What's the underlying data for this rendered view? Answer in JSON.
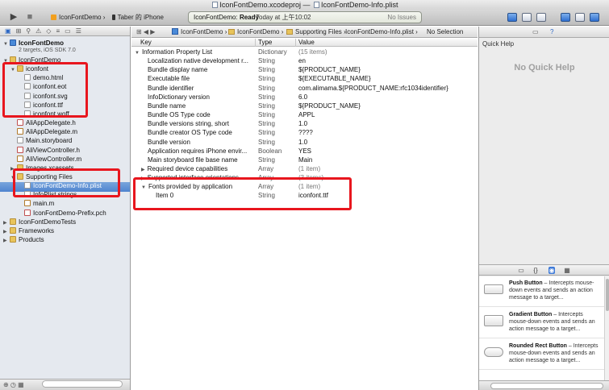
{
  "window": {
    "title_project": "IconFontDemo.xcodeproj",
    "title_sep": "—",
    "title_file": "IconFontDemo-Info.plist"
  },
  "toolbar": {
    "run_icon": "▶",
    "stop_icon": "■",
    "scheme_target": "IconFontDemo",
    "scheme_sep": "›",
    "scheme_device": "Taber 的 iPhone",
    "status_project": "IconFontDemo:",
    "status_state": "Ready",
    "status_time": "Today at 上午10:02",
    "status_issues": "No Issues"
  },
  "navigator": {
    "filter_icons": [
      "▣",
      "⊞",
      "⚲",
      "⚠",
      "◇",
      "≡",
      "▭",
      "☰"
    ],
    "project_name": "IconFontDemo",
    "project_subtitle": "2 targets, iOS SDK 7.0",
    "items": [
      {
        "label": "IconFontDemo",
        "kind": "folder",
        "indent": 1,
        "open": true
      },
      {
        "label": "iconfont",
        "kind": "folder",
        "indent": 2,
        "open": true
      },
      {
        "label": "demo.html",
        "kind": "file",
        "indent": 3
      },
      {
        "label": "iconfont.eot",
        "kind": "file",
        "indent": 3
      },
      {
        "label": "iconfont.svg",
        "kind": "file",
        "indent": 3
      },
      {
        "label": "iconfont.ttf",
        "kind": "file",
        "indent": 3
      },
      {
        "label": "iconfont.woff",
        "kind": "file",
        "indent": 3
      },
      {
        "label": "AliAppDelegate.h",
        "kind": "hfile",
        "indent": 2
      },
      {
        "label": "AliAppDelegate.m",
        "kind": "mfile",
        "indent": 2
      },
      {
        "label": "Main.storyboard",
        "kind": "file",
        "indent": 2
      },
      {
        "label": "AliViewController.h",
        "kind": "hfile",
        "indent": 2
      },
      {
        "label": "AliViewController.m",
        "kind": "mfile",
        "indent": 2
      },
      {
        "label": "Images.xcassets",
        "kind": "folder",
        "indent": 2
      },
      {
        "label": "Supporting Files",
        "kind": "folder",
        "indent": 2,
        "open": true
      },
      {
        "label": "IconFontDemo-Info.plist",
        "kind": "file",
        "indent": 3,
        "selected": true
      },
      {
        "label": "InfoPlist.strings",
        "kind": "file",
        "indent": 3
      },
      {
        "label": "main.m",
        "kind": "mfile",
        "indent": 3
      },
      {
        "label": "IconFontDemo-Prefix.pch",
        "kind": "hfile",
        "indent": 3
      },
      {
        "label": "IconFontDemoTests",
        "kind": "folder",
        "indent": 1
      },
      {
        "label": "Frameworks",
        "kind": "folder",
        "indent": 1
      },
      {
        "label": "Products",
        "kind": "folder",
        "indent": 1
      }
    ],
    "bottom_icons": "⊕  ◷  ▦"
  },
  "jumpbar": {
    "nav_icons": "⊞ ◀ ▶",
    "crumbs": [
      "IconFontDemo",
      "IconFontDemo",
      "Supporting Files",
      "IconFontDemo-Info.plist",
      "No Selection"
    ]
  },
  "plist": {
    "col_key": "Key",
    "col_type": "Type",
    "col_value": "Value",
    "rows": [
      {
        "key": "Information Property List",
        "type": "Dictionary",
        "value": "(15 items)",
        "level": 0,
        "arrow": "▼"
      },
      {
        "key": "Localization native development r...",
        "type": "String",
        "value": "en",
        "level": 1
      },
      {
        "key": "Bundle display name",
        "type": "String",
        "value": "${PRODUCT_NAME}",
        "level": 1
      },
      {
        "key": "Executable file",
        "type": "String",
        "value": "${EXECUTABLE_NAME}",
        "level": 1
      },
      {
        "key": "Bundle identifier",
        "type": "String",
        "value": "com.alimama.${PRODUCT_NAME:rfc1034identifier}",
        "level": 1
      },
      {
        "key": "InfoDictionary version",
        "type": "String",
        "value": "6.0",
        "level": 1
      },
      {
        "key": "Bundle name",
        "type": "String",
        "value": "${PRODUCT_NAME}",
        "level": 1
      },
      {
        "key": "Bundle OS Type code",
        "type": "String",
        "value": "APPL",
        "level": 1
      },
      {
        "key": "Bundle versions string, short",
        "type": "String",
        "value": "1.0",
        "level": 1
      },
      {
        "key": "Bundle creator OS Type code",
        "type": "String",
        "value": "????",
        "level": 1
      },
      {
        "key": "Bundle version",
        "type": "String",
        "value": "1.0",
        "level": 1
      },
      {
        "key": "Application requires iPhone envir...",
        "type": "Boolean",
        "value": "YES",
        "level": 1
      },
      {
        "key": "Main storyboard file base name",
        "type": "String",
        "value": "Main",
        "level": 1
      },
      {
        "key": "Required device capabilities",
        "type": "Array",
        "value": "(1 item)",
        "level": 1,
        "arrow": "▶"
      },
      {
        "key": "Supported interface orientations",
        "type": "Array",
        "value": "(3 items)",
        "level": 1,
        "arrow": "▶"
      },
      {
        "key": "Fonts provided by application",
        "type": "Array",
        "value": "(1 item)",
        "level": 1,
        "arrow": "▼"
      },
      {
        "key": "Item 0",
        "type": "String",
        "value": "iconfont.ttf",
        "level": 2
      }
    ]
  },
  "utility": {
    "tab_icons": [
      "▭",
      "?"
    ],
    "quick_help_title": "Quick Help",
    "quick_help_empty": "No Quick Help",
    "library_tabs": [
      "▭",
      "{}",
      "◉",
      "▦"
    ],
    "library_items": [
      {
        "name": "Push Button",
        "desc": " – Intercepts mouse-down events and sends an action message to a target..."
      },
      {
        "name": "Gradient Button",
        "desc": " – Intercepts mouse-down events and sends an action message to a target..."
      },
      {
        "name": "Rounded Rect Button",
        "desc": " – Intercepts mouse-down events and sends an action message to a target..."
      }
    ]
  }
}
